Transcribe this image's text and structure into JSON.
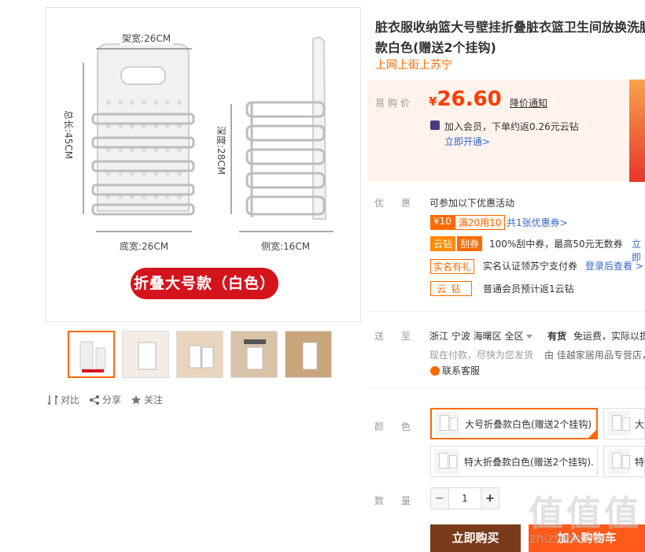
{
  "gallery": {
    "dims": {
      "frame_width": "架宽:26CM",
      "total_height": "总长:45CM",
      "depth": "深度:28CM",
      "bottom_width": "底宽:26CM",
      "side_width": "侧宽:16CM"
    },
    "banner": "折叠大号款（白色）",
    "thumbnails": [
      "thumb-1",
      "thumb-2",
      "thumb-3",
      "thumb-4",
      "thumb-5"
    ],
    "actions": {
      "compare": "对比",
      "share": "分享",
      "follow": "关注"
    }
  },
  "product": {
    "title_line1": "脏衣服收纳篮大号壁挂折叠脏衣篮卫生间放换洗脏",
    "title_line2": "款白色(赠送2个挂钩)",
    "subtitle": "上网上街上苏宁"
  },
  "price": {
    "label": "易购价",
    "currency": "¥",
    "value": "26.60",
    "notify": "降价通知",
    "member_text": "加入会员，下单约返0.26元云钻",
    "open_link": "立即开通>"
  },
  "promotions": {
    "label": "优惠",
    "head": "可参加以下优惠活动",
    "coupon_amount": "¥10",
    "coupon_condition": "满20用10",
    "coupon_link": "共1张优惠券>",
    "cloud_tag": "云钻",
    "scratch_tag": "刮券",
    "scratch_text": "100%刮中券，最高50元无数券",
    "scratch_link": "立即",
    "realname_tag": "实名有礼",
    "realname_text": "实名认证领苏宁支付券",
    "realname_link": "登录后查看 >",
    "yunzuan_tag": "云钻",
    "yunzuan_text": "普通会员预计返1云钻"
  },
  "shipping": {
    "label": "送至",
    "location": "浙江 宁波 海曙区 全区",
    "stock": "有货",
    "freight": "免运费，实际以提",
    "note": "现在付款，尽快为您发货",
    "seller": "由 佳越家居用品专营店，",
    "service": "联系客服"
  },
  "colors": {
    "label": "颜色",
    "options": [
      {
        "label": "大号折叠款白色(赠送2个挂钩)",
        "selected": true
      },
      {
        "label": "大",
        "selected": false
      },
      {
        "label": "特大折叠款白色(赠送2个挂钩).",
        "selected": false
      },
      {
        "label": "特",
        "selected": false
      }
    ]
  },
  "quantity": {
    "label": "数量",
    "value": "1",
    "minus": "−",
    "plus": "+"
  },
  "buttons": {
    "buy_now": "立即购买",
    "add_cart": "加入购物车"
  },
  "watermark": {
    "main": "值值值",
    "sub": "zhizhide.com"
  },
  "colors_theme": {
    "accent": "#ff6a00",
    "price": "#ff3c00",
    "link": "#3366cc",
    "buy_now": "#7a3b1a"
  }
}
